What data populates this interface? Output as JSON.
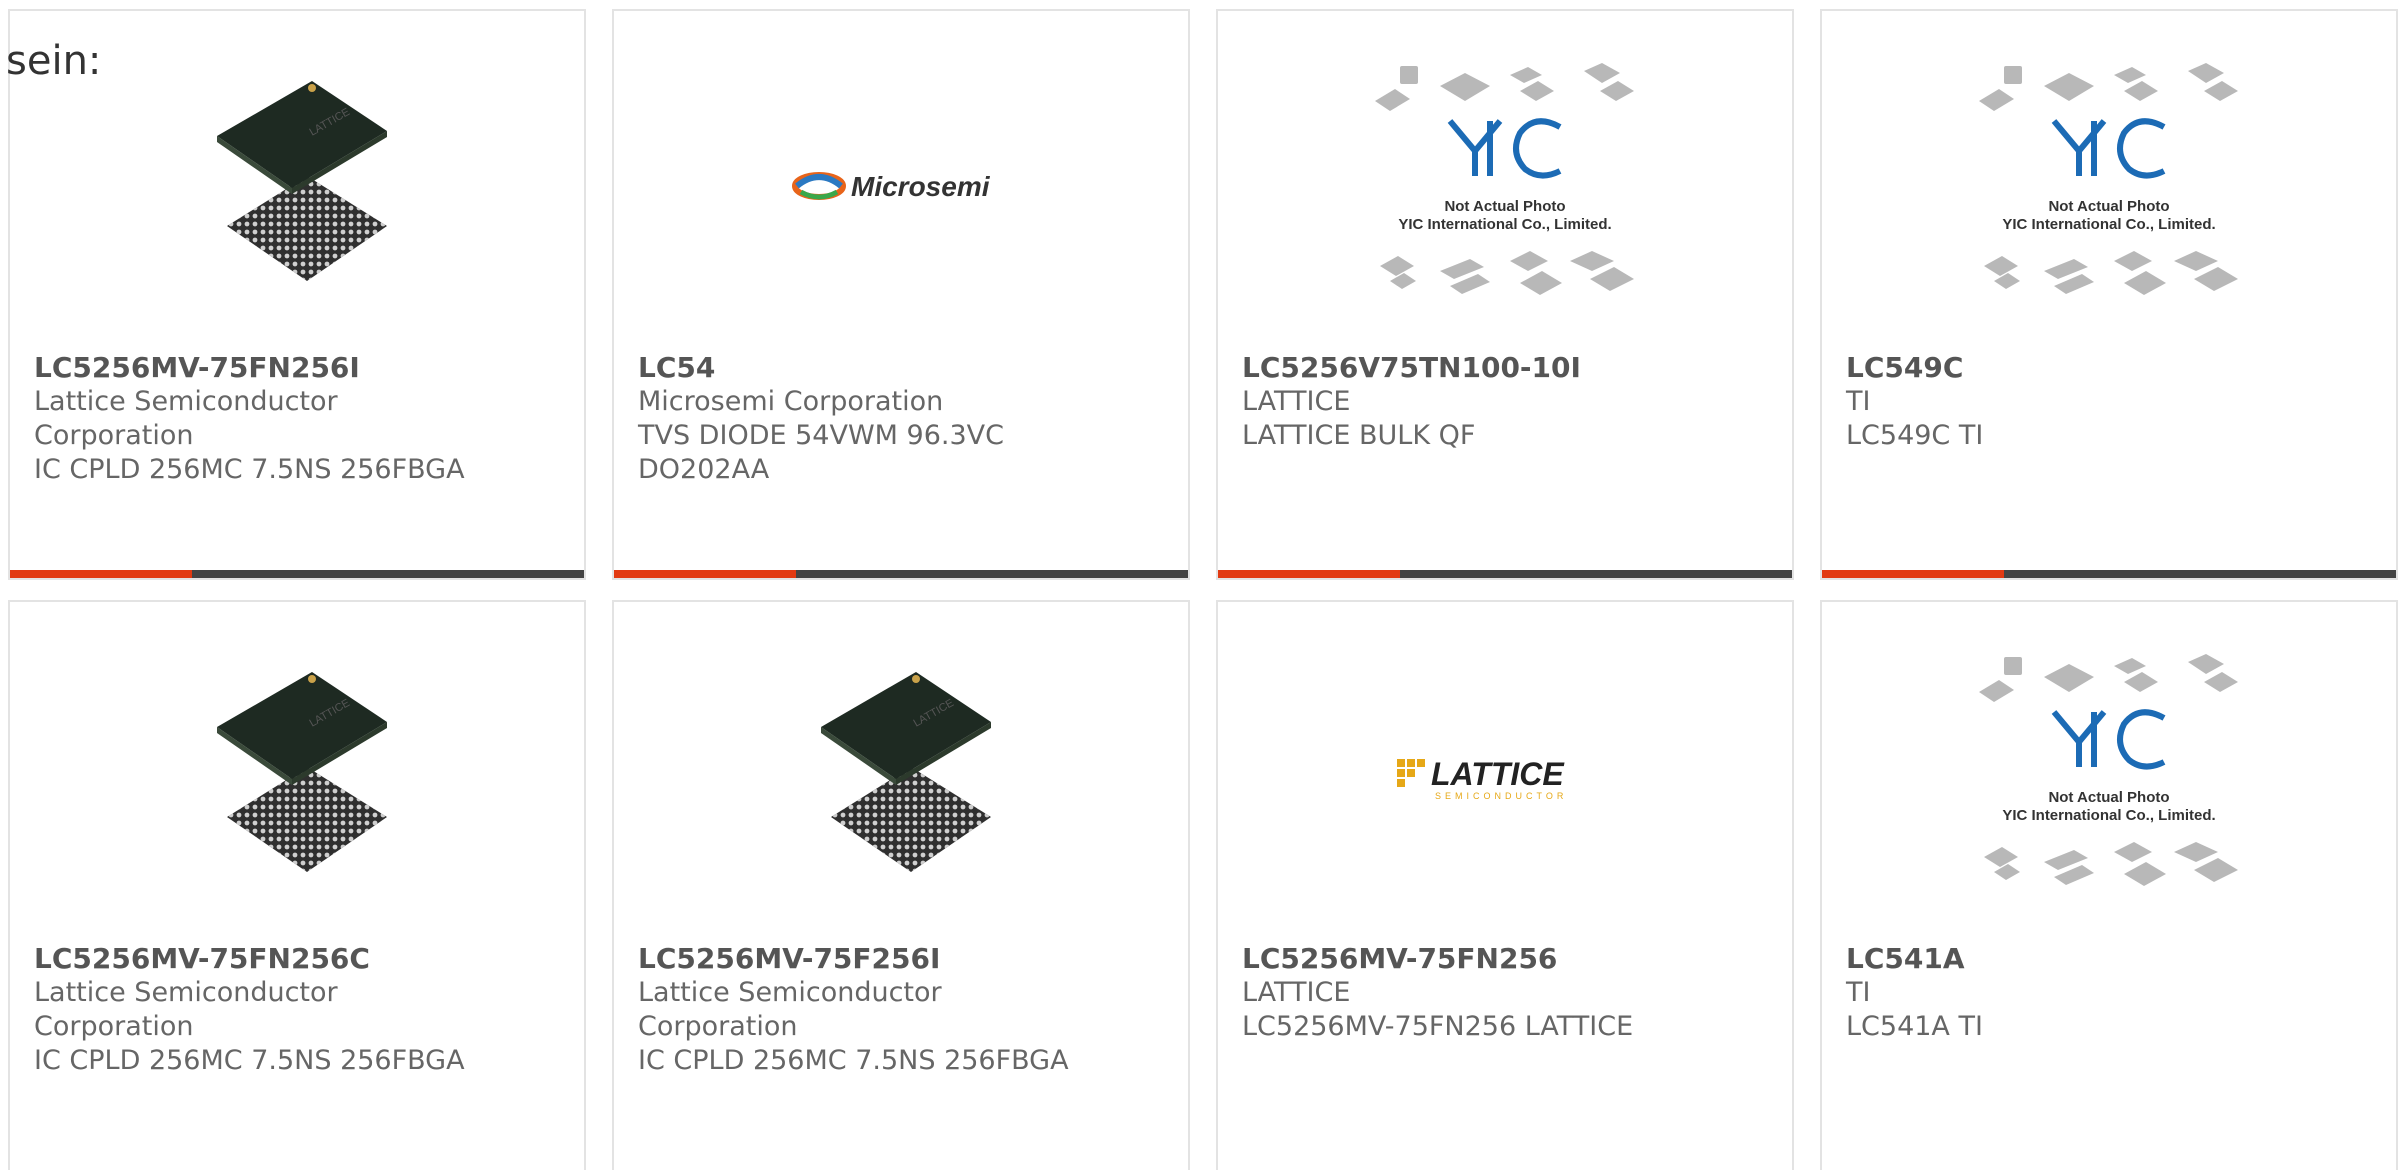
{
  "intro": "sein:",
  "colors": {
    "accent": "#e23a12",
    "bar": "#444444"
  },
  "not_actual_photo": {
    "line1": "Not Actual Photo",
    "line2": "YIC International Co., Limited."
  },
  "logos": {
    "microsemi": "Microsemi",
    "lattice": "LATTICE",
    "lattice_sub": "SEMICONDUCTOR"
  },
  "cards": [
    {
      "part": "LC5256MV-75FN256I",
      "lines": [
        "Lattice Semiconductor",
        "Corporation",
        "IC CPLD 256MC 7.5NS 256FBGA"
      ],
      "image": "bga-chip"
    },
    {
      "part": "LC54",
      "lines": [
        "Microsemi Corporation",
        "TVS DIODE 54VWM 96.3VC",
        "DO202AA"
      ],
      "image": "microsemi-logo"
    },
    {
      "part": "LC5256V75TN100-10I",
      "lines": [
        "LATTICE",
        "LATTICE BULK QF"
      ],
      "image": "yic-placeholder"
    },
    {
      "part": "LC549C",
      "lines": [
        "TI",
        "LC549C TI"
      ],
      "image": "yic-placeholder"
    },
    {
      "part": "LC5256MV-75FN256C",
      "lines": [
        "Lattice Semiconductor",
        "Corporation",
        "IC CPLD 256MC 7.5NS 256FBGA"
      ],
      "image": "bga-chip"
    },
    {
      "part": "LC5256MV-75F256I",
      "lines": [
        "Lattice Semiconductor",
        "Corporation",
        "IC CPLD 256MC 7.5NS 256FBGA"
      ],
      "image": "bga-chip"
    },
    {
      "part": "LC5256MV-75FN256",
      "lines": [
        "LATTICE",
        "LC5256MV-75FN256 LATTICE"
      ],
      "image": "lattice-logo"
    },
    {
      "part": "LC541A",
      "lines": [
        "TI",
        "LC541A TI"
      ],
      "image": "yic-placeholder"
    }
  ]
}
